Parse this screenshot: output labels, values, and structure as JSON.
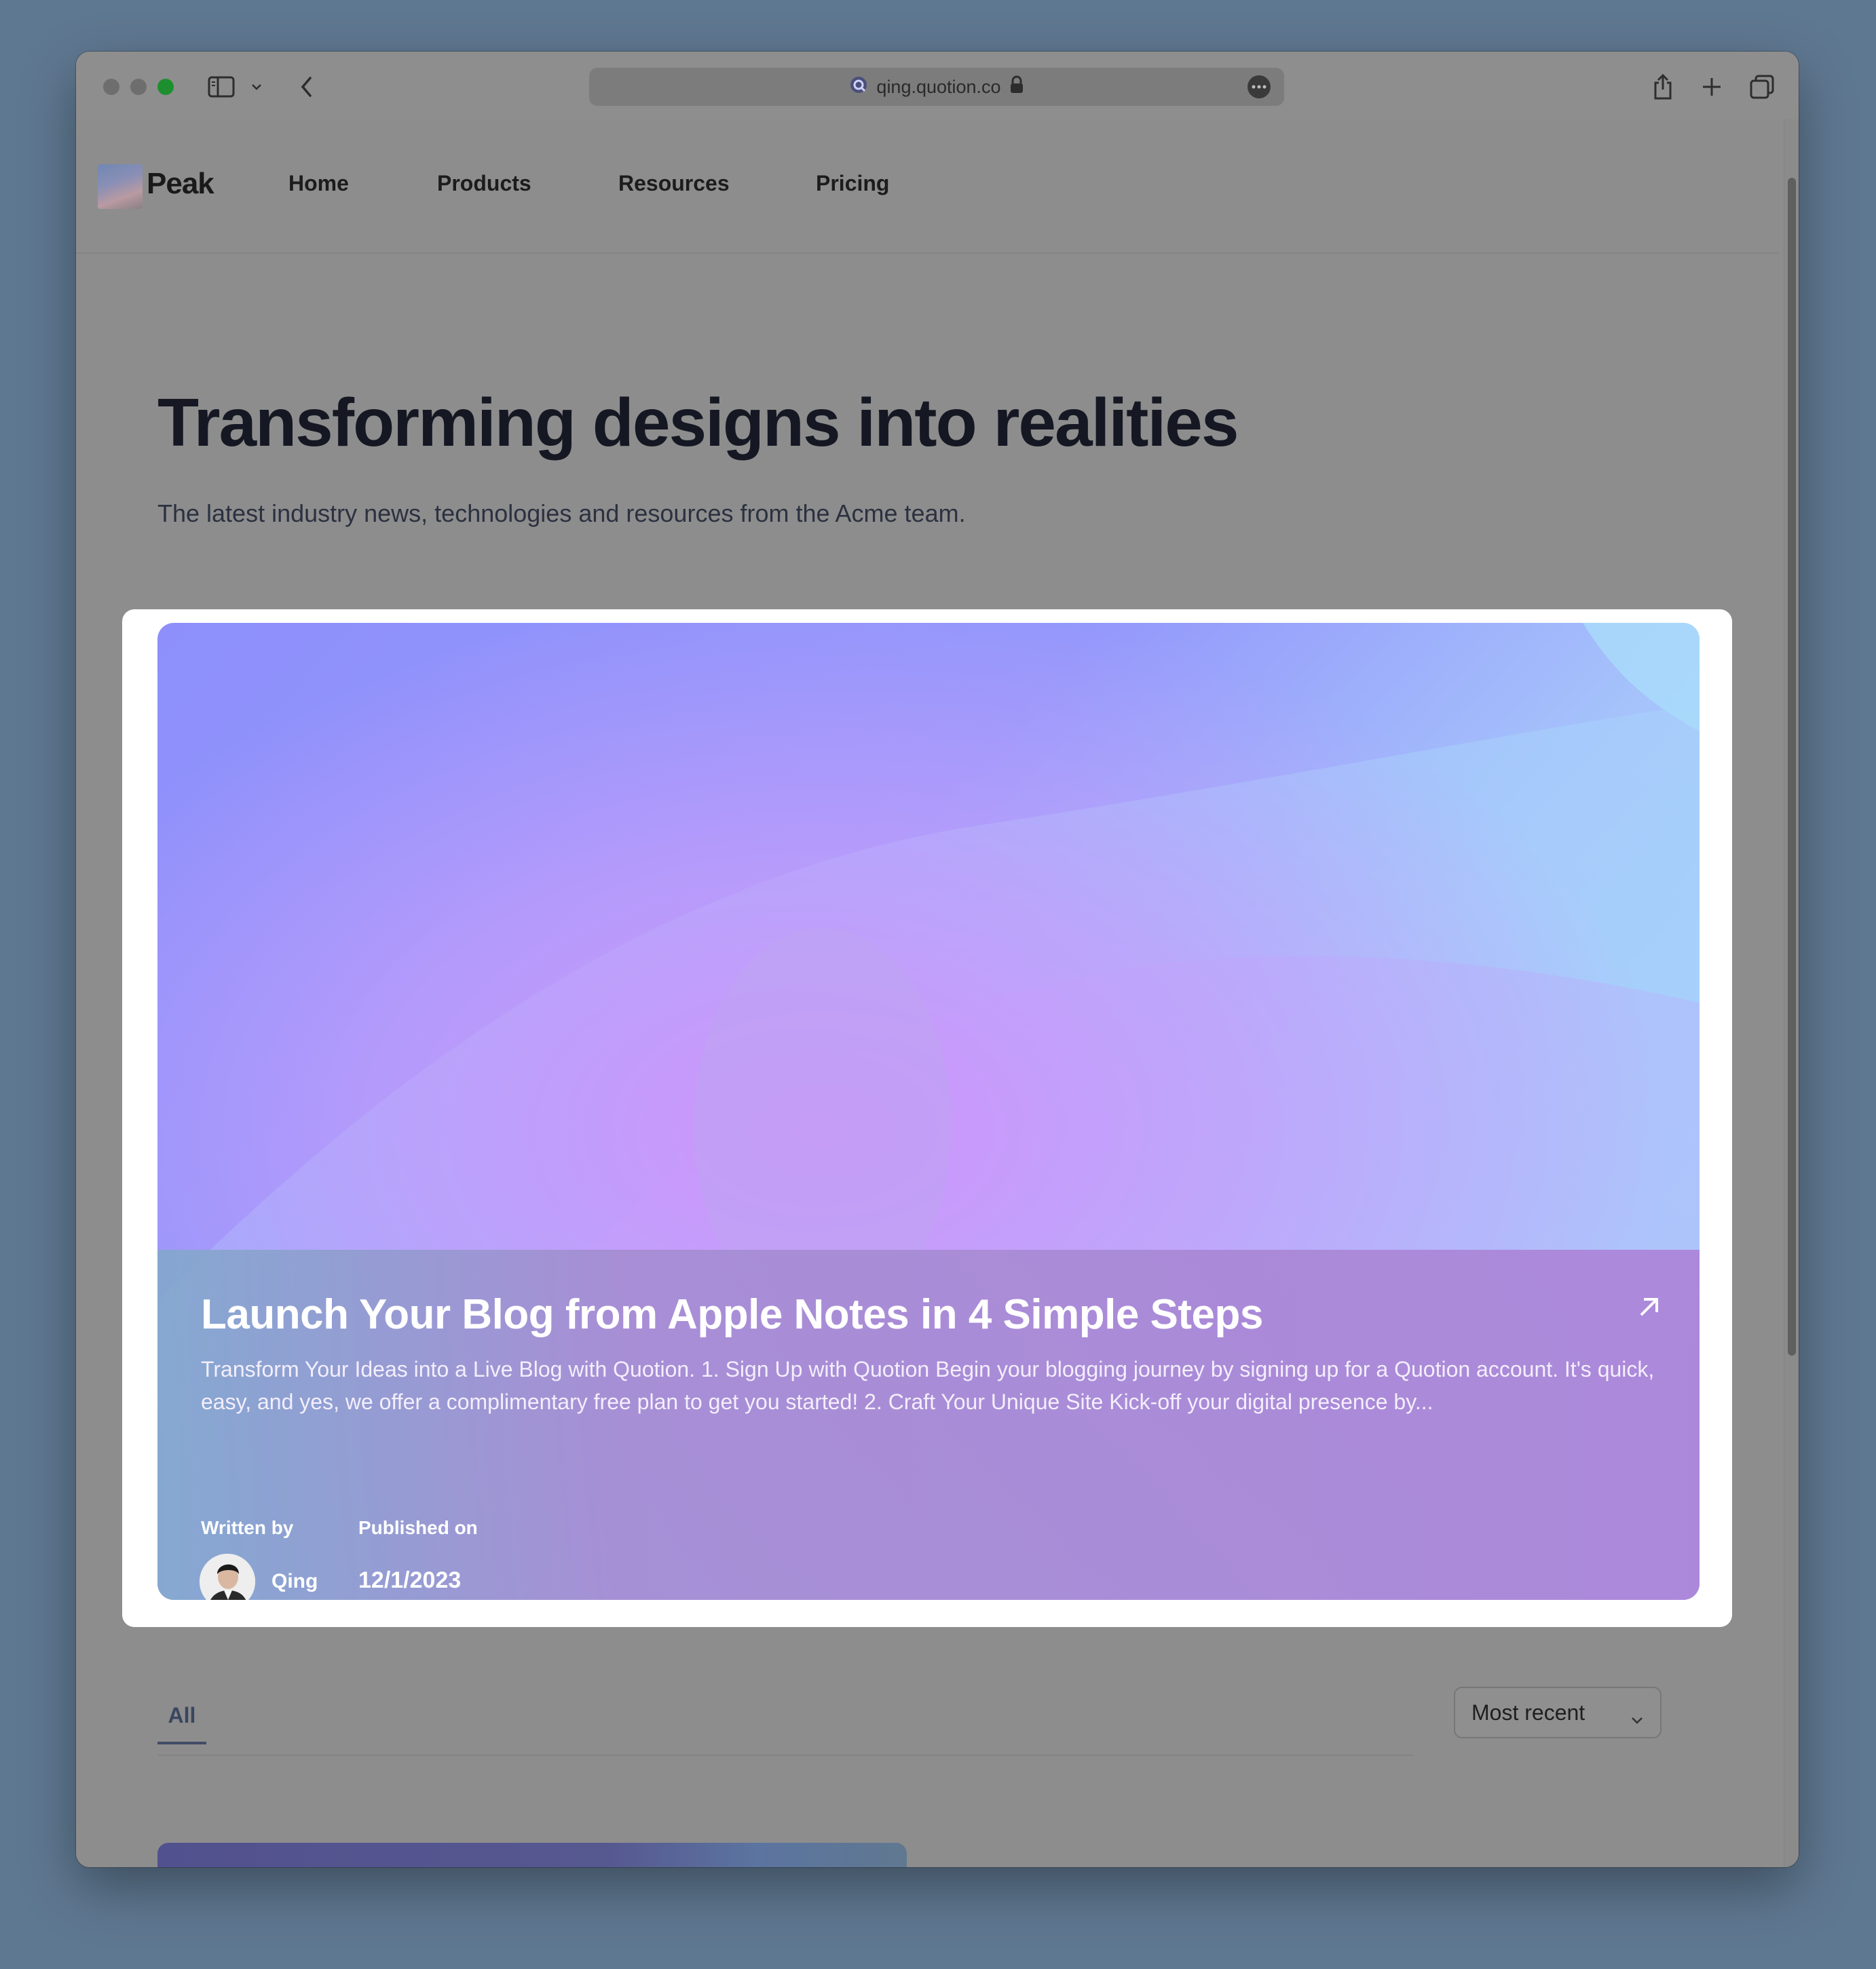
{
  "browser": {
    "url": "qing.quotion.co",
    "traffic_light_colors": [
      "#6e6e6e",
      "#6e6e6e",
      "#1e8f2f"
    ]
  },
  "site": {
    "brand": "Peak",
    "nav": [
      {
        "label": "Home"
      },
      {
        "label": "Products"
      },
      {
        "label": "Resources"
      },
      {
        "label": "Pricing"
      }
    ]
  },
  "hero": {
    "title": "Transforming designs into realities",
    "subtitle": "The latest industry news, technologies and resources from the Acme team."
  },
  "featured": {
    "title": "Launch Your Blog from Apple Notes in 4 Simple Steps",
    "excerpt": "Transform Your Ideas into a Live Blog with Quotion. 1. Sign Up with Quotion Begin your blogging journey by signing up for a Quotion account. It's quick, easy, and yes, we offer a complimentary free plan to get you started! 2. Craft Your Unique Site Kick-off your digital presence by...",
    "written_by_label": "Written by",
    "author": "Qing",
    "published_label": "Published on",
    "date": "12/1/2023"
  },
  "filters": {
    "tabs": [
      {
        "label": "All",
        "active": true
      }
    ],
    "sort_value": "Most recent"
  },
  "icons": {
    "sidebar": "sidebar-icon",
    "back": "chevron-left-icon",
    "share": "share-icon",
    "new_tab": "plus-icon",
    "tabs": "tabs-overview-icon",
    "external": "arrow-up-right-icon"
  }
}
